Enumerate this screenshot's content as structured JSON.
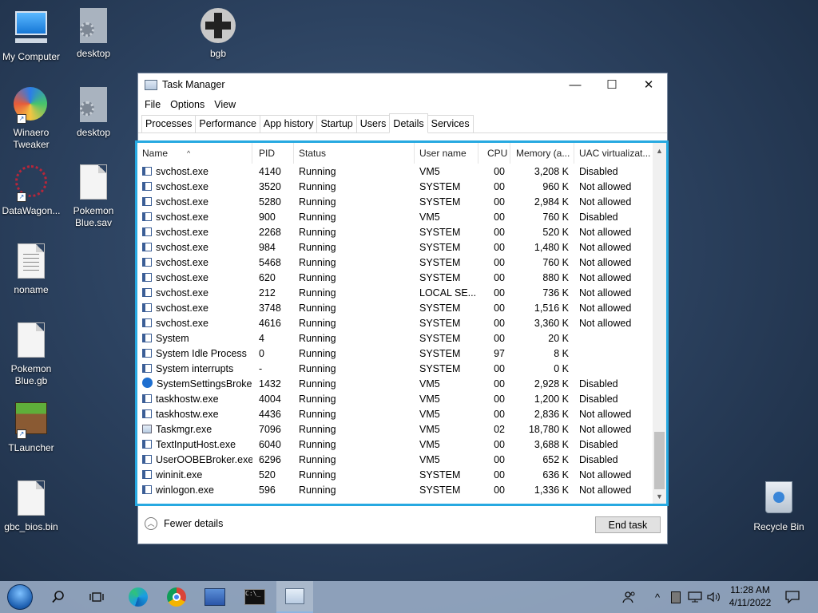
{
  "desktop": {
    "icons": [
      {
        "label": "My Computer"
      },
      {
        "label": "desktop"
      },
      {
        "label": "bgb"
      },
      {
        "label": "Winaero Tweaker"
      },
      {
        "label": "desktop"
      },
      {
        "label": "DataWagon..."
      },
      {
        "label": "Pokemon Blue.sav"
      },
      {
        "label": "noname"
      },
      {
        "label": "Pokemon Blue.gb"
      },
      {
        "label": "TLauncher"
      },
      {
        "label": "gbc_bios.bin"
      },
      {
        "label": "Recycle Bin"
      }
    ]
  },
  "window": {
    "title": "Task Manager",
    "minimize": "—",
    "maximize": "☐",
    "close": "✕",
    "menu": [
      "File",
      "Options",
      "View"
    ],
    "tabs": [
      "Processes",
      "Performance",
      "App history",
      "Startup",
      "Users",
      "Details",
      "Services"
    ],
    "active_tab": "Details",
    "columns": [
      "Name",
      "PID",
      "Status",
      "User name",
      "CPU",
      "Memory (a...",
      "UAC virtualizat..."
    ],
    "rows": [
      {
        "name": "svchost.exe",
        "pid": "4140",
        "status": "Running",
        "user": "VM5",
        "cpu": "00",
        "mem": "3,208 K",
        "uac": "Disabled",
        "icon": "svc"
      },
      {
        "name": "svchost.exe",
        "pid": "3520",
        "status": "Running",
        "user": "SYSTEM",
        "cpu": "00",
        "mem": "960 K",
        "uac": "Not allowed",
        "icon": "svc"
      },
      {
        "name": "svchost.exe",
        "pid": "5280",
        "status": "Running",
        "user": "SYSTEM",
        "cpu": "00",
        "mem": "2,984 K",
        "uac": "Not allowed",
        "icon": "svc"
      },
      {
        "name": "svchost.exe",
        "pid": "900",
        "status": "Running",
        "user": "VM5",
        "cpu": "00",
        "mem": "760 K",
        "uac": "Disabled",
        "icon": "svc"
      },
      {
        "name": "svchost.exe",
        "pid": "2268",
        "status": "Running",
        "user": "SYSTEM",
        "cpu": "00",
        "mem": "520 K",
        "uac": "Not allowed",
        "icon": "svc"
      },
      {
        "name": "svchost.exe",
        "pid": "984",
        "status": "Running",
        "user": "SYSTEM",
        "cpu": "00",
        "mem": "1,480 K",
        "uac": "Not allowed",
        "icon": "svc"
      },
      {
        "name": "svchost.exe",
        "pid": "5468",
        "status": "Running",
        "user": "SYSTEM",
        "cpu": "00",
        "mem": "760 K",
        "uac": "Not allowed",
        "icon": "svc"
      },
      {
        "name": "svchost.exe",
        "pid": "620",
        "status": "Running",
        "user": "SYSTEM",
        "cpu": "00",
        "mem": "880 K",
        "uac": "Not allowed",
        "icon": "svc"
      },
      {
        "name": "svchost.exe",
        "pid": "212",
        "status": "Running",
        "user": "LOCAL SE...",
        "cpu": "00",
        "mem": "736 K",
        "uac": "Not allowed",
        "icon": "svc"
      },
      {
        "name": "svchost.exe",
        "pid": "3748",
        "status": "Running",
        "user": "SYSTEM",
        "cpu": "00",
        "mem": "1,516 K",
        "uac": "Not allowed",
        "icon": "svc"
      },
      {
        "name": "svchost.exe",
        "pid": "4616",
        "status": "Running",
        "user": "SYSTEM",
        "cpu": "00",
        "mem": "3,360 K",
        "uac": "Not allowed",
        "icon": "svc"
      },
      {
        "name": "System",
        "pid": "4",
        "status": "Running",
        "user": "SYSTEM",
        "cpu": "00",
        "mem": "20 K",
        "uac": "",
        "icon": "svc"
      },
      {
        "name": "System Idle Process",
        "pid": "0",
        "status": "Running",
        "user": "SYSTEM",
        "cpu": "97",
        "mem": "8 K",
        "uac": "",
        "icon": "svc"
      },
      {
        "name": "System interrupts",
        "pid": "-",
        "status": "Running",
        "user": "SYSTEM",
        "cpu": "00",
        "mem": "0 K",
        "uac": "",
        "icon": "svc"
      },
      {
        "name": "SystemSettingsBroke...",
        "pid": "1432",
        "status": "Running",
        "user": "VM5",
        "cpu": "00",
        "mem": "2,928 K",
        "uac": "Disabled",
        "icon": "gear"
      },
      {
        "name": "taskhostw.exe",
        "pid": "4004",
        "status": "Running",
        "user": "VM5",
        "cpu": "00",
        "mem": "1,200 K",
        "uac": "Disabled",
        "icon": "svc"
      },
      {
        "name": "taskhostw.exe",
        "pid": "4436",
        "status": "Running",
        "user": "VM5",
        "cpu": "00",
        "mem": "2,836 K",
        "uac": "Not allowed",
        "icon": "svc"
      },
      {
        "name": "Taskmgr.exe",
        "pid": "7096",
        "status": "Running",
        "user": "VM5",
        "cpu": "02",
        "mem": "18,780 K",
        "uac": "Not allowed",
        "icon": "tm"
      },
      {
        "name": "TextInputHost.exe",
        "pid": "6040",
        "status": "Running",
        "user": "VM5",
        "cpu": "00",
        "mem": "3,688 K",
        "uac": "Disabled",
        "icon": "svc"
      },
      {
        "name": "UserOOBEBroker.exe",
        "pid": "6296",
        "status": "Running",
        "user": "VM5",
        "cpu": "00",
        "mem": "652 K",
        "uac": "Disabled",
        "icon": "svc"
      },
      {
        "name": "wininit.exe",
        "pid": "520",
        "status": "Running",
        "user": "SYSTEM",
        "cpu": "00",
        "mem": "636 K",
        "uac": "Not allowed",
        "icon": "svc"
      },
      {
        "name": "winlogon.exe",
        "pid": "596",
        "status": "Running",
        "user": "SYSTEM",
        "cpu": "00",
        "mem": "1,336 K",
        "uac": "Not allowed",
        "icon": "svc"
      }
    ],
    "fewer_details": "Fewer details",
    "end_task": "End task"
  },
  "taskbar": {
    "clock_time": "11:28 AM",
    "clock_date": "4/11/2022",
    "accent": "#27a9e1"
  }
}
